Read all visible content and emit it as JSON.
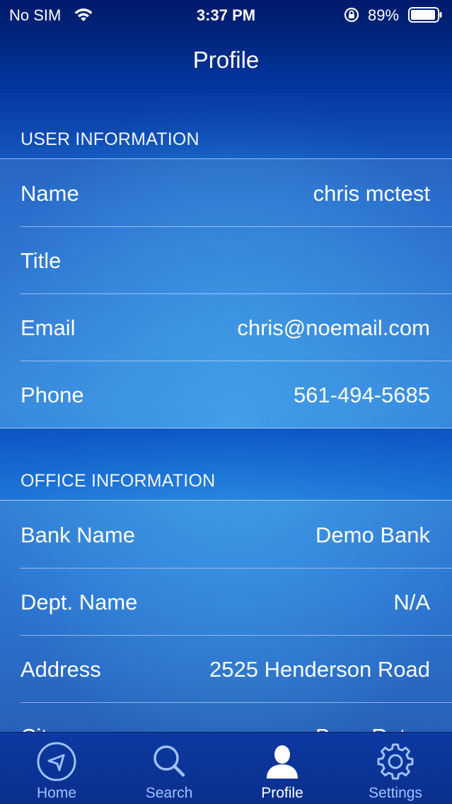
{
  "status_bar": {
    "carrier": "No SIM",
    "time": "3:37 PM",
    "battery_percent": "89%"
  },
  "nav": {
    "title": "Profile"
  },
  "user_section": {
    "header": "USER INFORMATION",
    "rows": [
      {
        "label": "Name",
        "value": "chris mctest"
      },
      {
        "label": "Title",
        "value": ""
      },
      {
        "label": "Email",
        "value": "chris@noemail.com"
      },
      {
        "label": "Phone",
        "value": "561-494-5685"
      }
    ]
  },
  "office_section": {
    "header": "OFFICE INFORMATION",
    "rows": [
      {
        "label": "Bank Name",
        "value": "Demo Bank"
      },
      {
        "label": "Dept. Name",
        "value": "N/A"
      },
      {
        "label": "Address",
        "value": "2525 Henderson Road"
      },
      {
        "label": "City",
        "value": "Boca Raton"
      }
    ]
  },
  "tabs": [
    {
      "label": "Home",
      "icon": "home-icon"
    },
    {
      "label": "Search",
      "icon": "search-icon"
    },
    {
      "label": "Profile",
      "icon": "profile-icon",
      "active": true
    },
    {
      "label": "Settings",
      "icon": "gear-icon"
    }
  ],
  "colors": {
    "nav_background": "#00247a",
    "tab_inactive": "#9fc2ff",
    "tab_active": "#ffffff"
  }
}
